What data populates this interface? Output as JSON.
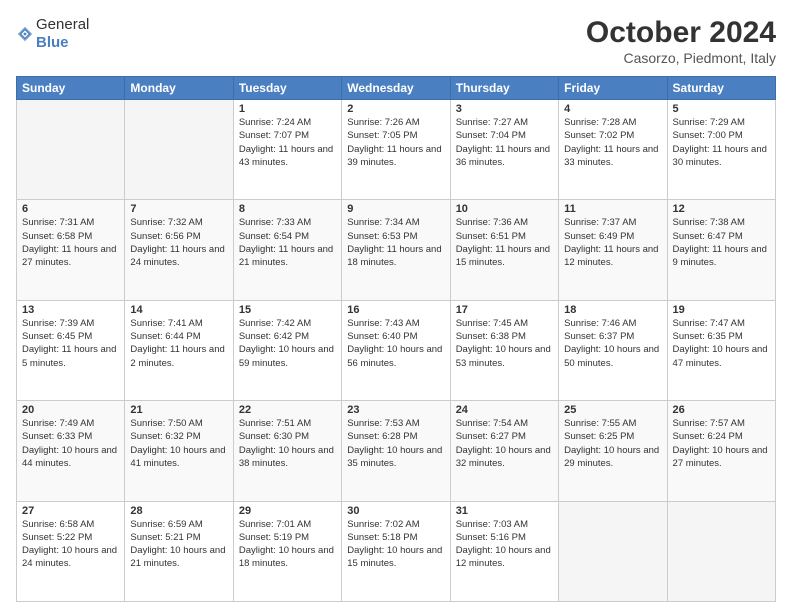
{
  "header": {
    "logo_general": "General",
    "logo_blue": "Blue",
    "title": "October 2024",
    "location": "Casorzo, Piedmont, Italy"
  },
  "days_of_week": [
    "Sunday",
    "Monday",
    "Tuesday",
    "Wednesday",
    "Thursday",
    "Friday",
    "Saturday"
  ],
  "weeks": [
    [
      {
        "day": "",
        "empty": true
      },
      {
        "day": "",
        "empty": true
      },
      {
        "day": "1",
        "sunrise": "Sunrise: 7:24 AM",
        "sunset": "Sunset: 7:07 PM",
        "daylight": "Daylight: 11 hours and 43 minutes."
      },
      {
        "day": "2",
        "sunrise": "Sunrise: 7:26 AM",
        "sunset": "Sunset: 7:05 PM",
        "daylight": "Daylight: 11 hours and 39 minutes."
      },
      {
        "day": "3",
        "sunrise": "Sunrise: 7:27 AM",
        "sunset": "Sunset: 7:04 PM",
        "daylight": "Daylight: 11 hours and 36 minutes."
      },
      {
        "day": "4",
        "sunrise": "Sunrise: 7:28 AM",
        "sunset": "Sunset: 7:02 PM",
        "daylight": "Daylight: 11 hours and 33 minutes."
      },
      {
        "day": "5",
        "sunrise": "Sunrise: 7:29 AM",
        "sunset": "Sunset: 7:00 PM",
        "daylight": "Daylight: 11 hours and 30 minutes."
      }
    ],
    [
      {
        "day": "6",
        "sunrise": "Sunrise: 7:31 AM",
        "sunset": "Sunset: 6:58 PM",
        "daylight": "Daylight: 11 hours and 27 minutes."
      },
      {
        "day": "7",
        "sunrise": "Sunrise: 7:32 AM",
        "sunset": "Sunset: 6:56 PM",
        "daylight": "Daylight: 11 hours and 24 minutes."
      },
      {
        "day": "8",
        "sunrise": "Sunrise: 7:33 AM",
        "sunset": "Sunset: 6:54 PM",
        "daylight": "Daylight: 11 hours and 21 minutes."
      },
      {
        "day": "9",
        "sunrise": "Sunrise: 7:34 AM",
        "sunset": "Sunset: 6:53 PM",
        "daylight": "Daylight: 11 hours and 18 minutes."
      },
      {
        "day": "10",
        "sunrise": "Sunrise: 7:36 AM",
        "sunset": "Sunset: 6:51 PM",
        "daylight": "Daylight: 11 hours and 15 minutes."
      },
      {
        "day": "11",
        "sunrise": "Sunrise: 7:37 AM",
        "sunset": "Sunset: 6:49 PM",
        "daylight": "Daylight: 11 hours and 12 minutes."
      },
      {
        "day": "12",
        "sunrise": "Sunrise: 7:38 AM",
        "sunset": "Sunset: 6:47 PM",
        "daylight": "Daylight: 11 hours and 9 minutes."
      }
    ],
    [
      {
        "day": "13",
        "sunrise": "Sunrise: 7:39 AM",
        "sunset": "Sunset: 6:45 PM",
        "daylight": "Daylight: 11 hours and 5 minutes."
      },
      {
        "day": "14",
        "sunrise": "Sunrise: 7:41 AM",
        "sunset": "Sunset: 6:44 PM",
        "daylight": "Daylight: 11 hours and 2 minutes."
      },
      {
        "day": "15",
        "sunrise": "Sunrise: 7:42 AM",
        "sunset": "Sunset: 6:42 PM",
        "daylight": "Daylight: 10 hours and 59 minutes."
      },
      {
        "day": "16",
        "sunrise": "Sunrise: 7:43 AM",
        "sunset": "Sunset: 6:40 PM",
        "daylight": "Daylight: 10 hours and 56 minutes."
      },
      {
        "day": "17",
        "sunrise": "Sunrise: 7:45 AM",
        "sunset": "Sunset: 6:38 PM",
        "daylight": "Daylight: 10 hours and 53 minutes."
      },
      {
        "day": "18",
        "sunrise": "Sunrise: 7:46 AM",
        "sunset": "Sunset: 6:37 PM",
        "daylight": "Daylight: 10 hours and 50 minutes."
      },
      {
        "day": "19",
        "sunrise": "Sunrise: 7:47 AM",
        "sunset": "Sunset: 6:35 PM",
        "daylight": "Daylight: 10 hours and 47 minutes."
      }
    ],
    [
      {
        "day": "20",
        "sunrise": "Sunrise: 7:49 AM",
        "sunset": "Sunset: 6:33 PM",
        "daylight": "Daylight: 10 hours and 44 minutes."
      },
      {
        "day": "21",
        "sunrise": "Sunrise: 7:50 AM",
        "sunset": "Sunset: 6:32 PM",
        "daylight": "Daylight: 10 hours and 41 minutes."
      },
      {
        "day": "22",
        "sunrise": "Sunrise: 7:51 AM",
        "sunset": "Sunset: 6:30 PM",
        "daylight": "Daylight: 10 hours and 38 minutes."
      },
      {
        "day": "23",
        "sunrise": "Sunrise: 7:53 AM",
        "sunset": "Sunset: 6:28 PM",
        "daylight": "Daylight: 10 hours and 35 minutes."
      },
      {
        "day": "24",
        "sunrise": "Sunrise: 7:54 AM",
        "sunset": "Sunset: 6:27 PM",
        "daylight": "Daylight: 10 hours and 32 minutes."
      },
      {
        "day": "25",
        "sunrise": "Sunrise: 7:55 AM",
        "sunset": "Sunset: 6:25 PM",
        "daylight": "Daylight: 10 hours and 29 minutes."
      },
      {
        "day": "26",
        "sunrise": "Sunrise: 7:57 AM",
        "sunset": "Sunset: 6:24 PM",
        "daylight": "Daylight: 10 hours and 27 minutes."
      }
    ],
    [
      {
        "day": "27",
        "sunrise": "Sunrise: 6:58 AM",
        "sunset": "Sunset: 5:22 PM",
        "daylight": "Daylight: 10 hours and 24 minutes."
      },
      {
        "day": "28",
        "sunrise": "Sunrise: 6:59 AM",
        "sunset": "Sunset: 5:21 PM",
        "daylight": "Daylight: 10 hours and 21 minutes."
      },
      {
        "day": "29",
        "sunrise": "Sunrise: 7:01 AM",
        "sunset": "Sunset: 5:19 PM",
        "daylight": "Daylight: 10 hours and 18 minutes."
      },
      {
        "day": "30",
        "sunrise": "Sunrise: 7:02 AM",
        "sunset": "Sunset: 5:18 PM",
        "daylight": "Daylight: 10 hours and 15 minutes."
      },
      {
        "day": "31",
        "sunrise": "Sunrise: 7:03 AM",
        "sunset": "Sunset: 5:16 PM",
        "daylight": "Daylight: 10 hours and 12 minutes."
      },
      {
        "day": "",
        "empty": true
      },
      {
        "day": "",
        "empty": true
      }
    ]
  ]
}
